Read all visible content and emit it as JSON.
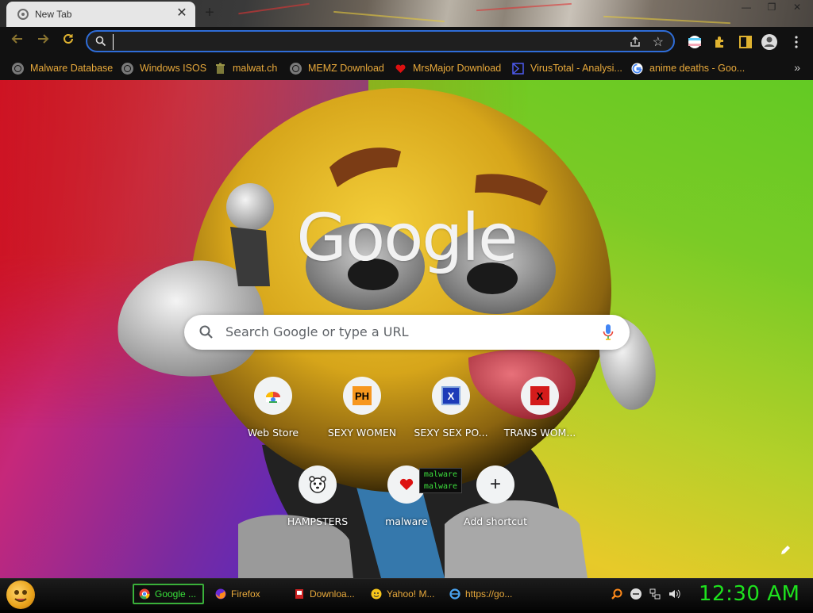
{
  "tab": {
    "title": "New Tab",
    "close": "✕",
    "new_tab": "+"
  },
  "window_controls": {
    "minimize": "—",
    "restore": "❐",
    "close": "✕"
  },
  "omnibox": {
    "value": "",
    "placeholder": ""
  },
  "bookmarks": [
    {
      "label": "Malware Database",
      "icon": "globe-icon"
    },
    {
      "label": "Windows ISOS",
      "icon": "globe-icon"
    },
    {
      "label": "malwat.ch",
      "icon": "trash-icon"
    },
    {
      "label": "MEMZ Download",
      "icon": "globe-icon"
    },
    {
      "label": "MrsMajor Download",
      "icon": "heart-icon"
    },
    {
      "label": "VirusTotal - Analysi...",
      "icon": "virustotal-icon"
    },
    {
      "label": "anime deaths - Goo...",
      "icon": "google-icon"
    }
  ],
  "bookmarks_overflow": "»",
  "google_logo": "Google",
  "search": {
    "placeholder": "Search Google or type a URL"
  },
  "shortcuts": [
    {
      "label": "Web Store",
      "icon": "web-store-icon"
    },
    {
      "label": "SEXY WOMEN",
      "icon": "ph-icon",
      "icon_text": "PH"
    },
    {
      "label": "SEXY SEX PO...",
      "icon": "x-icon",
      "icon_text": "X"
    },
    {
      "label": "TRANS WOM...",
      "icon": "x-red-icon",
      "icon_text": "X"
    },
    {
      "label": "HAMPSTERS",
      "icon": "hamster-icon"
    },
    {
      "label": "malware",
      "icon": "heart-icon"
    },
    {
      "label": "Add shortcut",
      "icon": "plus-icon",
      "icon_text": "+"
    }
  ],
  "tooltip": [
    "malware",
    "malware"
  ],
  "taskbar": {
    "tasks": [
      {
        "label": "Google ...",
        "icon": "chrome-icon",
        "active": true
      },
      {
        "label": "Firefox",
        "icon": "firefox-icon",
        "active": false
      },
      {
        "label": "Downloa...",
        "icon": "download-icon",
        "active": false
      },
      {
        "label": "Yahoo! M...",
        "icon": "yahoo-icon",
        "active": false
      },
      {
        "label": "https://go...",
        "icon": "ie-icon",
        "active": false
      }
    ],
    "clock": "12:30 AM"
  },
  "colors": {
    "bookmark_text": "#e8a93b",
    "omnibox_border": "#2f6dd8",
    "clock": "#1ee11e",
    "tooltip_text": "#3dde3d"
  }
}
